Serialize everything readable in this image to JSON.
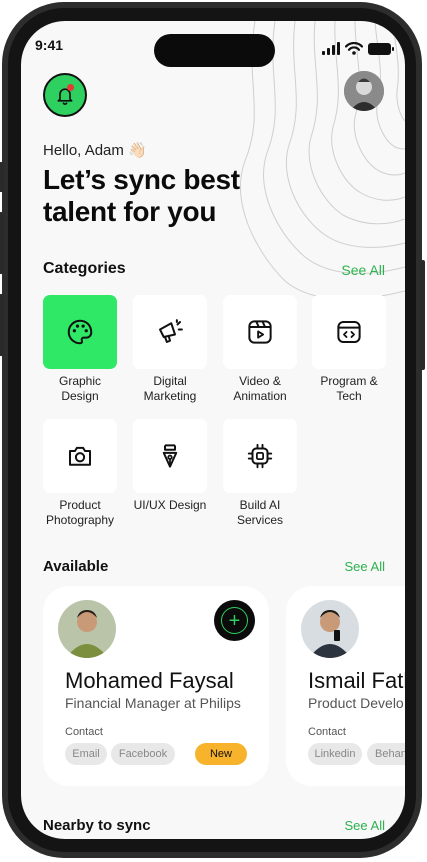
{
  "status_bar": {
    "time": "9:41"
  },
  "header": {
    "bell_icon": "bell-icon",
    "avatar_icon": "user-avatar",
    "accent": "#2ed05f",
    "notification_dot": "#e53935"
  },
  "greeting": "Hello, Adam 👋🏻",
  "hero": "Let’s sync best talent for you",
  "categories": {
    "title": "Categories",
    "see_all": "See All",
    "items": [
      {
        "label": "Graphic Design",
        "icon": "palette-icon",
        "active": true
      },
      {
        "label": "Digital Marketing",
        "icon": "megaphone-icon"
      },
      {
        "label": "Video & Animation",
        "icon": "video-play-icon"
      },
      {
        "label": "Program & Tech",
        "icon": "code-icon"
      },
      {
        "label": "Product Photography",
        "icon": "camera-icon"
      },
      {
        "label": "UI/UX Design",
        "icon": "pen-tool-icon"
      },
      {
        "label": "Build AI Services",
        "icon": "chip-icon"
      }
    ]
  },
  "available": {
    "title": "Available",
    "see_all": "See All",
    "cards": [
      {
        "name": "Mohamed Faysal",
        "role": "Financial Manager at Philips",
        "contact_label": "Contact",
        "chips": [
          "Email",
          "Facebook"
        ],
        "badge": "New"
      },
      {
        "name": "Ismail Fath",
        "role": "Product Develo",
        "contact_label": "Contact",
        "chips": [
          "Linkedin",
          "Behan"
        ]
      }
    ]
  },
  "nearby": {
    "title": "Nearby to sync",
    "see_all": "See All"
  }
}
